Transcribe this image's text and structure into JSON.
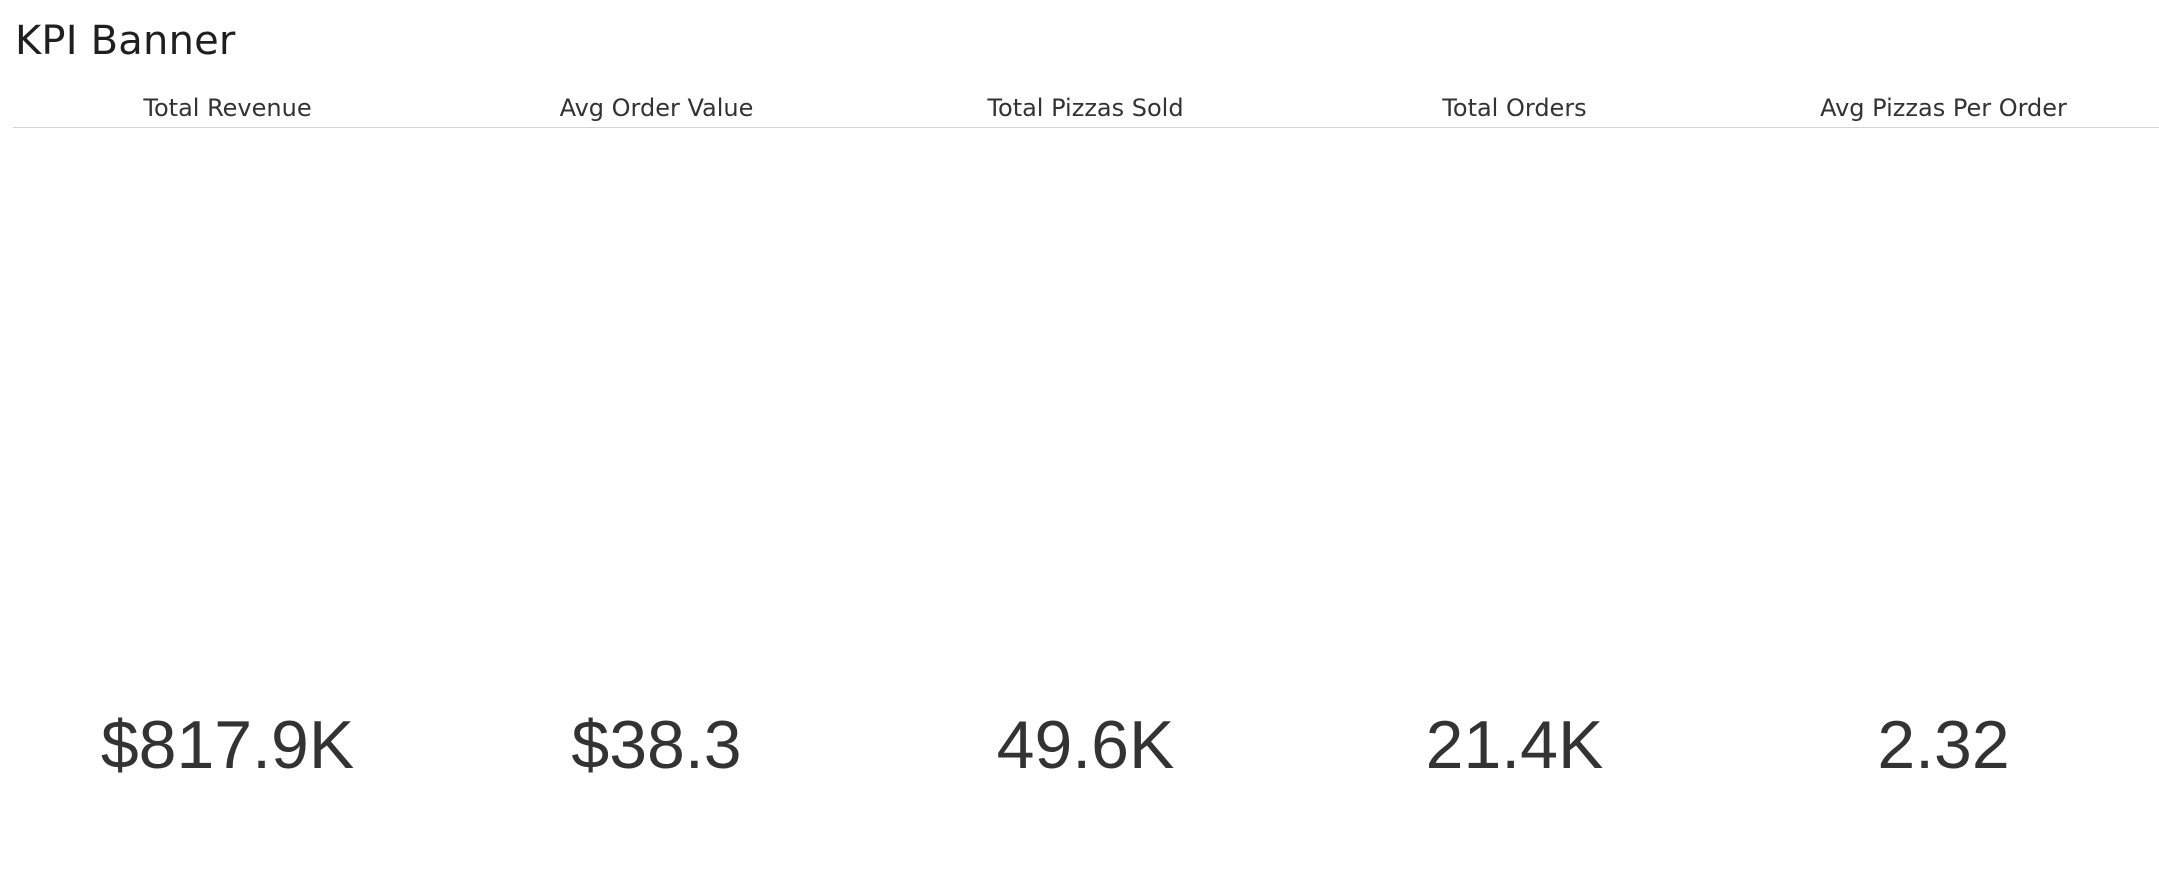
{
  "title": "KPI Banner",
  "kpis": [
    {
      "label": "Total Revenue",
      "value": "$817.9K"
    },
    {
      "label": "Avg Order Value",
      "value": "$38.3"
    },
    {
      "label": "Total Pizzas Sold",
      "value": "49.6K"
    },
    {
      "label": "Total Orders",
      "value": "21.4K"
    },
    {
      "label": "Avg Pizzas Per Order",
      "value": "2.32"
    }
  ],
  "colors": {
    "text": "#333333",
    "title": "#1f1f1f",
    "divider": "#d4d4d4",
    "background": "#ffffff"
  }
}
